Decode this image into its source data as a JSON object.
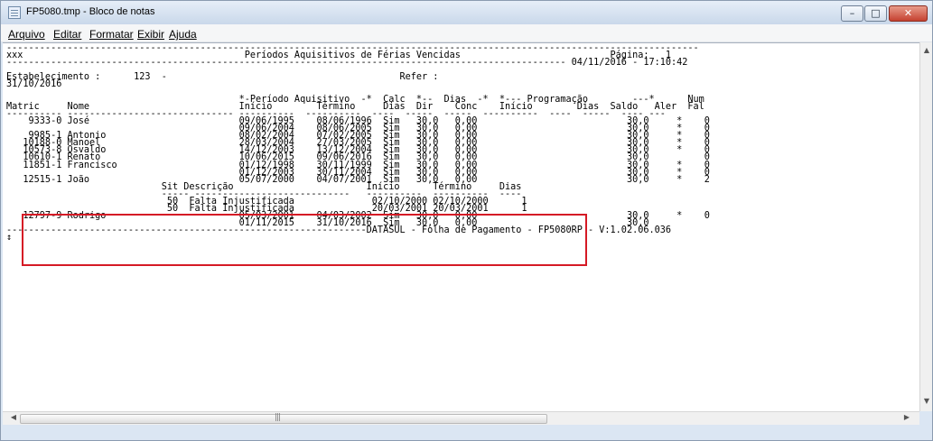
{
  "window": {
    "title": "FP5080.tmp - Bloco de notas",
    "controls": {
      "minimize": "–",
      "maximize": "□",
      "close": "✕"
    }
  },
  "menu": [
    {
      "label": "Arquivo"
    },
    {
      "label": "Editar"
    },
    {
      "label": "Formatar"
    },
    {
      "label": "Exibir"
    },
    {
      "label": "Ajuda"
    }
  ],
  "report": {
    "lines": [
      "-----------------------------------------------------------------------------------------------------------------------------",
      "xxx                                        Períodos Aquisitivos de Férias Vencidas                           Página:   1",
      "----------------------------------------------------------------------------------------------------- 04/11/2016 - 17:10:42",
      "",
      "Estabelecimento :      123  -                                          Refer :",
      "31/10/2016",
      "",
      "                                          *-Período Aquisitivo  -*  Calc  *--  Dias  -*  *--- Programação        ---*      Num",
      "Matric     Nome                           Início        Término     Dias  Dir    Conc    Início        Dias  Saldo   Aler  Fal",
      "---------- ------------------------------ ----------  ----------  ----  -----  -----  ----------  ----  -----  ---- ---",
      "    9333-0 José                           09/06/1995    08/06/1996  Sim   30,0   0,00                           30,0     *    0",
      "                                          09/06/2004    08/06/2005  Sim   30,0   0,00                           30,0     *    0",
      "    9985-1 Antonio                        08/02/2004    07/02/2005  Sim   30,0   0,00                           30,0     *    0",
      "   10188-0 Manoel                         28/03/2004    27/03/2005  Sim   30,0   0,00                           30,0     *    0",
      "   10573-8 Osvaldo                        14/12/2003    13/12/2004  Sim   30,0   0,00                           30,0     *    0",
      "   10610-1 Renato                         10/06/2015    09/06/2016  Sim   30,0   0,00                           30,0          0",
      "   11851-1 Francisco                      01/12/1998    30/11/1999  Sim   30,0   0,00                           30,0     *    0",
      "                                          01/12/2003    30/11/2004  Sim   30,0   0,00                           30,0     *    0",
      "   12515-1 João                           05/07/2000    04/07/2001  Sim   30,0   0,00                           30,0     *    2",
      "                            Sit Descrição                        Início      Término     Dias",
      "                            ----- ----------------------------   ----------  ----------  ----",
      "                             50  Falta Injustificada              02/10/2000 02/10/2000      1",
      "                             50  Falta Injustificada              20/03/2001 20/03/2001      1",
      "   12797-9 Rodrigo                        05/03/2001    04/03/2002  Sim   30,0   0,00                           30,0     *    0",
      "                                          01/11/2015    31/10/2016  Sim   30,0   0,00                           30,0",
      "-----------------------------------------------------------------DATASUL - Folha de Pagamento - FP5080RP - V:1.02.06.036",
      "↕"
    ]
  }
}
